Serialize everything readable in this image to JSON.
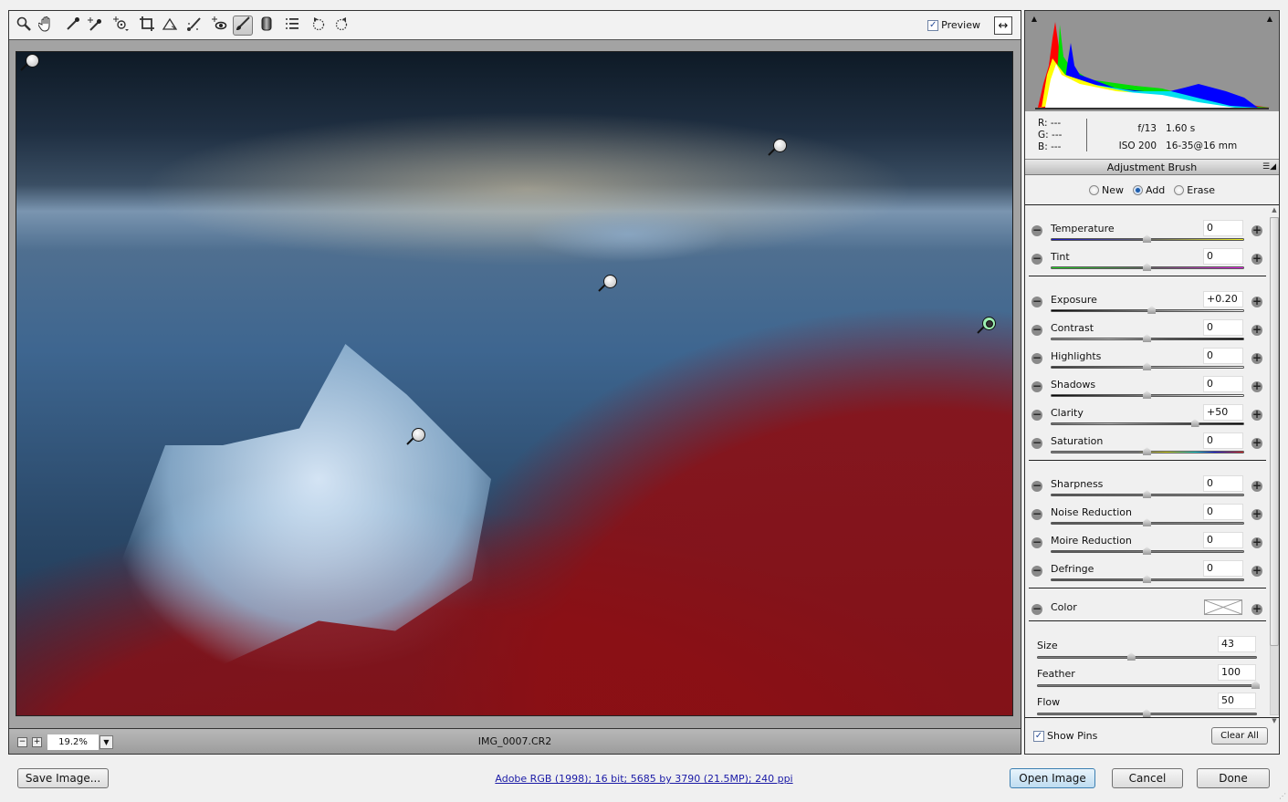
{
  "toolbar": {
    "tools": [
      {
        "name": "zoom-tool",
        "icon": "magnifier-icon"
      },
      {
        "name": "hand-tool",
        "icon": "hand-icon"
      },
      {
        "name": "white-balance-tool",
        "icon": "eyedropper-icon"
      },
      {
        "name": "color-sampler-tool",
        "icon": "eyedropper-plus-icon"
      },
      {
        "name": "targeted-adjustment-tool",
        "icon": "target-icon"
      },
      {
        "name": "crop-tool",
        "icon": "crop-icon"
      },
      {
        "name": "straighten-tool",
        "icon": "straighten-icon"
      },
      {
        "name": "spot-removal-tool",
        "icon": "spot-brush-icon"
      },
      {
        "name": "red-eye-removal-tool",
        "icon": "red-eye-icon"
      },
      {
        "name": "adjustment-brush-tool",
        "icon": "brush-icon",
        "active": true
      },
      {
        "name": "graduated-filter-tool",
        "icon": "gradient-icon"
      },
      {
        "name": "preferences-tool",
        "icon": "list-icon"
      },
      {
        "name": "rotate-ccw-tool",
        "icon": "rotate-left-icon"
      },
      {
        "name": "rotate-cw-tool",
        "icon": "rotate-right-icon"
      }
    ],
    "preview_label": "Preview",
    "preview_checked": true,
    "check_glyph": "✓",
    "fullscreen_glyph": "↔"
  },
  "statusbar": {
    "zoom_out": "−",
    "zoom_in": "+",
    "zoom_value": "19.2%",
    "zoom_dropdown": "▼",
    "filename": "IMG_0007.CR2"
  },
  "histogram": {
    "shadow_clip": "▲",
    "highlight_clip": "▲"
  },
  "info": {
    "r_label": "R:",
    "r_value": "---",
    "g_label": "G:",
    "g_value": "---",
    "b_label": "B:",
    "b_value": "---",
    "aperture": "f/13",
    "shutter": "1.60 s",
    "iso": "ISO 200",
    "lens": "16-35@16 mm"
  },
  "panel": {
    "title": "Adjustment Brush",
    "menu_glyph": "☰◢",
    "modes": [
      {
        "label": "New",
        "selected": false
      },
      {
        "label": "Add",
        "selected": true
      },
      {
        "label": "Erase",
        "selected": false
      }
    ],
    "minus_glyph": "−",
    "plus_glyph": "+",
    "group1": [
      {
        "label": "Temperature",
        "value": "0",
        "position": 0.5,
        "gradient": "linear-gradient(90deg,#1818c0,#666 50%,#f0f020)"
      },
      {
        "label": "Tint",
        "value": "0",
        "position": 0.5,
        "gradient": "linear-gradient(90deg,#20e020,#666 50%,#f020f0)"
      }
    ],
    "group2": [
      {
        "label": "Exposure",
        "value": "+0.20",
        "position": 0.525,
        "gradient": "linear-gradient(90deg,#000,#fff)"
      },
      {
        "label": "Contrast",
        "value": "0",
        "position": 0.5,
        "gradient": "linear-gradient(90deg,#888,#ccc 30%,#555 60%,#000)"
      },
      {
        "label": "Highlights",
        "value": "0",
        "position": 0.5,
        "gradient": "linear-gradient(90deg,#333,#fff)"
      },
      {
        "label": "Shadows",
        "value": "0",
        "position": 0.5,
        "gradient": "linear-gradient(90deg,#000,#fff)"
      },
      {
        "label": "Clarity",
        "value": "+50",
        "position": 0.75,
        "gradient": "linear-gradient(90deg,#777,#bbb 30%,#444 70%,#000)"
      },
      {
        "label": "Saturation",
        "value": "0",
        "position": 0.5,
        "gradient": "linear-gradient(90deg,#888,#888 45%,#e0e020 60%,#20e0e0 75%,#2020f0 85%,#f02020)"
      }
    ],
    "group3": [
      {
        "label": "Sharpness",
        "value": "0",
        "position": 0.5,
        "gradient": "linear-gradient(90deg,#555,#999)"
      },
      {
        "label": "Noise Reduction",
        "value": "0",
        "position": 0.5,
        "gradient": "linear-gradient(90deg,#555,#999)"
      },
      {
        "label": "Moire Reduction",
        "value": "0",
        "position": 0.5,
        "gradient": "linear-gradient(90deg,#555,#999)"
      },
      {
        "label": "Defringe",
        "value": "0",
        "position": 0.5,
        "gradient": "linear-gradient(90deg,#555,#999)"
      }
    ],
    "color_label": "Color",
    "brush": [
      {
        "label": "Size",
        "value": "43",
        "position": 0.43
      },
      {
        "label": "Feather",
        "value": "100",
        "position": 1.0
      },
      {
        "label": "Flow",
        "value": "50",
        "position": 0.5
      }
    ],
    "show_pins_label": "Show Pins",
    "show_pins_checked": true,
    "clear_all_label": "Clear All"
  },
  "footer": {
    "save_label": "Save Image...",
    "workflow_link": "Adobe RGB (1998); 16 bit; 5685 by 3790 (21.5MP); 240 ppi",
    "open_label": "Open Image",
    "cancel_label": "Cancel",
    "done_label": "Done"
  }
}
